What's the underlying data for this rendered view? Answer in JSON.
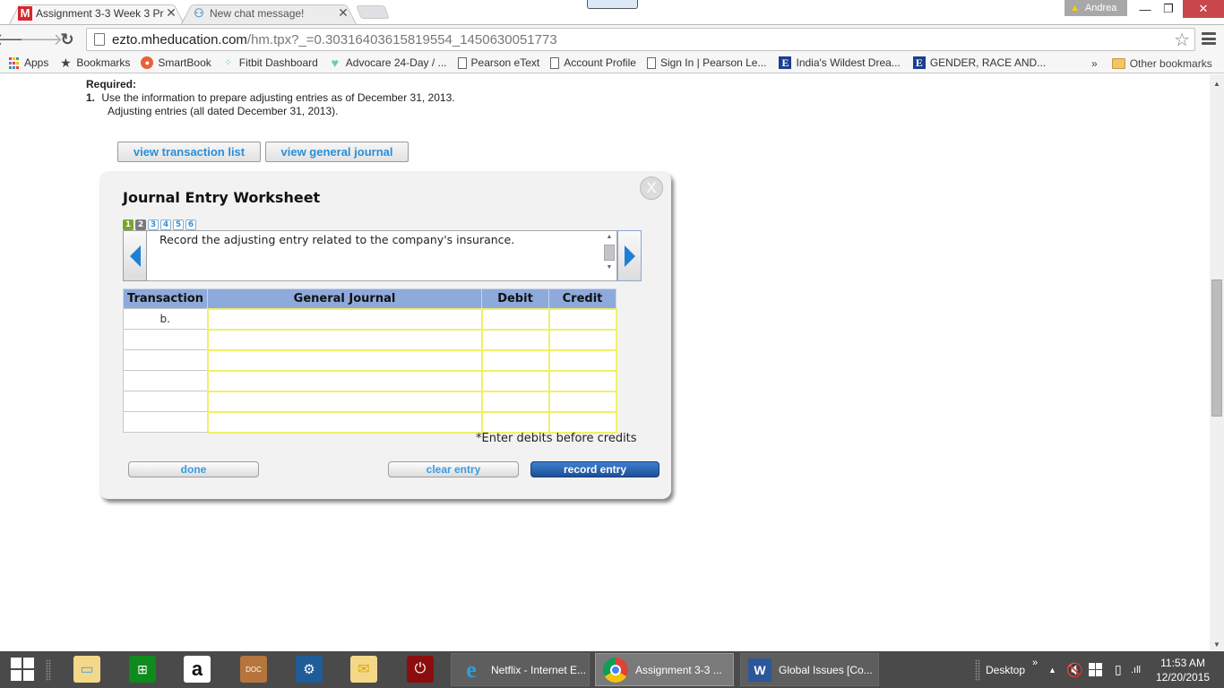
{
  "browser": {
    "tabs": [
      {
        "label": "Assignment 3-3 Week 3 Pr",
        "favicon": "mcgraw-hill-icon",
        "active": true
      },
      {
        "label": "New chat message!",
        "favicon": "chat-icon",
        "active": false
      }
    ],
    "profile_name": "Andrea",
    "url_host": "ezto.mheducation.com",
    "url_path": "/hm.tpx?_=0.30316403615819554_1450630051773",
    "bookmarks": [
      {
        "label": "Apps",
        "icon": "apps-grid-icon"
      },
      {
        "label": "Bookmarks",
        "icon": "star-icon"
      },
      {
        "label": "SmartBook",
        "icon": "smartbook-icon"
      },
      {
        "label": "Fitbit Dashboard",
        "icon": "fitbit-icon"
      },
      {
        "label": "Advocare 24-Day / ...",
        "icon": "heart-icon"
      },
      {
        "label": "Pearson eText",
        "icon": "page-icon"
      },
      {
        "label": "Account Profile",
        "icon": "page-icon"
      },
      {
        "label": "Sign In | Pearson Le...",
        "icon": "page-icon"
      },
      {
        "label": "India's Wildest Drea...",
        "icon": "e-icon"
      },
      {
        "label": "GENDER, RACE AND...",
        "icon": "e-icon"
      }
    ],
    "bookmarks_overflow": "»",
    "other_bookmarks": "Other bookmarks"
  },
  "page": {
    "required_heading": "Required:",
    "item_number": "1.",
    "item_text": "Use the information to prepare adjusting entries as of December 31, 2013.",
    "item_subtext": "Adjusting entries (all dated December 31, 2013).",
    "view_transaction_list": "view transaction list",
    "view_general_journal": "view general journal"
  },
  "worksheet": {
    "title": "Journal Entry Worksheet",
    "close_label": "X",
    "steps": [
      {
        "label": "1",
        "state": "done"
      },
      {
        "label": "2",
        "state": "current"
      },
      {
        "label": "3",
        "state": "todo"
      },
      {
        "label": "4",
        "state": "todo"
      },
      {
        "label": "5",
        "state": "todo"
      },
      {
        "label": "6",
        "state": "todo"
      }
    ],
    "prompt": "Record the adjusting entry related to the company's insurance.",
    "columns": [
      "Transaction",
      "General Journal",
      "Debit",
      "Credit"
    ],
    "rows": [
      {
        "transaction": "b.",
        "account": "",
        "debit": "",
        "credit": ""
      },
      {
        "transaction": "",
        "account": "",
        "debit": "",
        "credit": ""
      },
      {
        "transaction": "",
        "account": "",
        "debit": "",
        "credit": ""
      },
      {
        "transaction": "",
        "account": "",
        "debit": "",
        "credit": ""
      },
      {
        "transaction": "",
        "account": "",
        "debit": "",
        "credit": ""
      },
      {
        "transaction": "",
        "account": "",
        "debit": "",
        "credit": ""
      }
    ],
    "hint": "*Enter debits before credits",
    "done_label": "done",
    "clear_label": "clear entry",
    "record_label": "record entry"
  },
  "taskbar": {
    "pinned": [
      "start-icon",
      "file-explorer-icon",
      "store-icon",
      "amazon-icon",
      "doc-scanner-icon",
      "settings-app-icon",
      "outlook-icon",
      "power-icon"
    ],
    "tasks": [
      {
        "label": "Netflix - Internet E...",
        "icon": "internet-explorer-icon",
        "active": false
      },
      {
        "label": "Assignment 3-3 ...",
        "icon": "chrome-icon",
        "active": true
      },
      {
        "label": "Global Issues [Co...",
        "icon": "word-icon",
        "active": false
      }
    ],
    "desktop_label": "Desktop",
    "toolbar_overflow": "»",
    "time": "11:53 AM",
    "date": "12/20/2015"
  }
}
